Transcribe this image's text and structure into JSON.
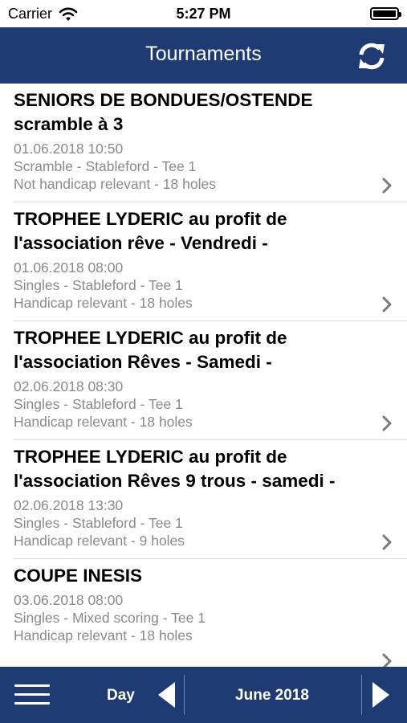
{
  "status_bar": {
    "carrier": "Carrier",
    "time": "5:27 PM"
  },
  "nav": {
    "title": "Tournaments",
    "refresh_icon": "refresh-icon"
  },
  "tournaments": [
    {
      "title_lines": [
        "SENIORS DE BONDUES/OSTENDE",
        "scramble à 3"
      ],
      "date": "01.06.2018 10:50",
      "format": "Scramble - Stableford - Tee 1",
      "info": "Not handicap relevant - 18 holes"
    },
    {
      "title_lines": [
        "TROPHEE LYDERIC au profit de",
        "l'association rêve - Vendredi -"
      ],
      "date": "01.06.2018 08:00",
      "format": "Singles - Stableford - Tee 1",
      "info": "Handicap relevant - 18 holes"
    },
    {
      "title_lines": [
        "TROPHEE LYDERIC au profit de",
        "l'association Rêves - Samedi -"
      ],
      "date": "02.06.2018 08:30",
      "format": "Singles - Stableford - Tee 1",
      "info": "Handicap relevant - 18 holes"
    },
    {
      "title_lines": [
        "TROPHEE LYDERIC au profit de",
        "l'association Rêves 9 trous - samedi -"
      ],
      "date": "02.06.2018 13:30",
      "format": "Singles - Stableford - Tee 1",
      "info": "Handicap relevant - 9 holes"
    },
    {
      "title_lines": [
        "COUPE INESIS"
      ],
      "date": "03.06.2018 08:00",
      "format": "Singles - Mixed scoring - Tee 1",
      "info": "Handicap relevant - 18 holes"
    }
  ],
  "toolbar": {
    "day_label": "Day",
    "month_label": "June 2018"
  },
  "colors": {
    "nav_background": "#1e3b74",
    "detail_text": "#8a8a8a"
  }
}
